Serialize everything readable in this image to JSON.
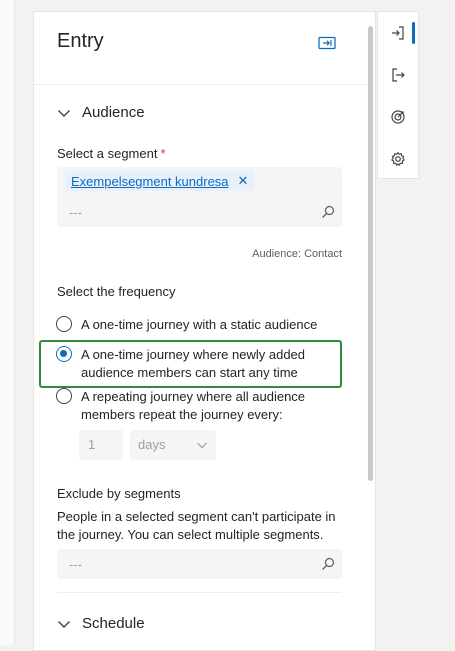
{
  "panel": {
    "title": "Entry",
    "audience_section": "Audience",
    "segment_label": "Select a segment",
    "required_mark": "*",
    "selected_segment": "Exempelsegment kundresa",
    "segment_search_placeholder": "---",
    "audience_type": "Audience: Contact",
    "frequency_label": "Select the frequency",
    "frequency_options": [
      {
        "label": "A one-time journey with a static audience",
        "selected": false
      },
      {
        "label": "A one-time journey where newly added audience members can start any time",
        "selected": true
      },
      {
        "label": "A repeating journey where all audience members repeat the journey every:",
        "selected": false
      }
    ],
    "repeat_value_placeholder": "1",
    "repeat_unit": "days",
    "exclude_label": "Exclude by segments",
    "exclude_help": "People in a selected segment can't participate in the journey. You can select multiple segments.",
    "exclude_placeholder": "---",
    "schedule_section": "Schedule"
  },
  "rail": {
    "items": [
      "entry-icon",
      "exit-icon",
      "goal-icon",
      "settings-icon"
    ],
    "active_index": 0
  },
  "colors": {
    "accent": "#0f6cbd",
    "highlight": "#2e8b3a",
    "required": "#c4314b"
  }
}
